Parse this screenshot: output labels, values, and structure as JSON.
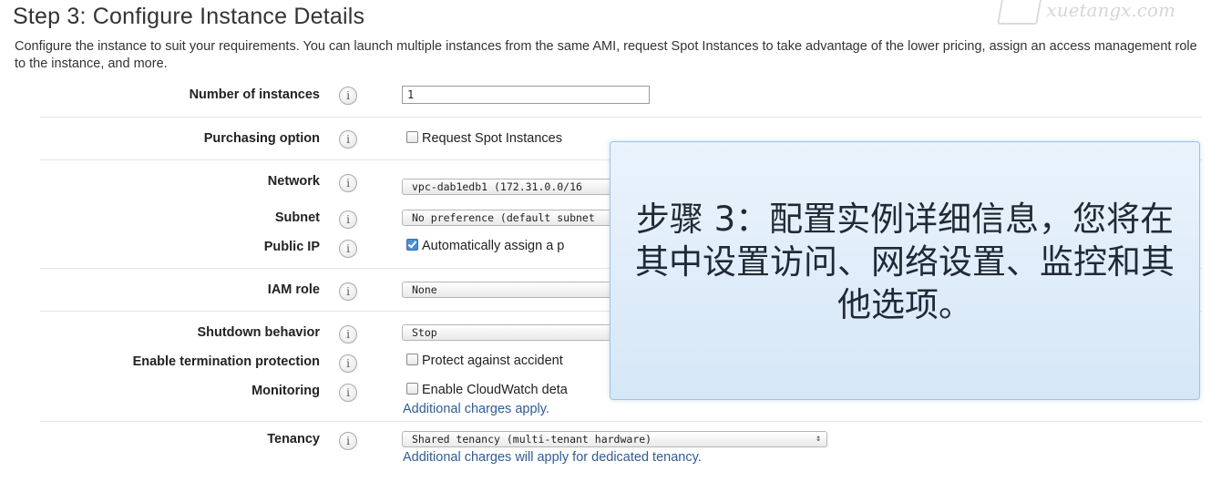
{
  "page": {
    "title": "Step 3: Configure Instance Details",
    "description": "Configure the instance to suit your requirements. You can launch multiple instances from the same AMI, request Spot Instances to take advantage of the lower pricing, assign an access management role to the instance, and more."
  },
  "watermark": {
    "text": "xuetangx.com"
  },
  "form": {
    "number_of_instances": {
      "label": "Number of instances",
      "value": "1",
      "info_icon": "i"
    },
    "purchasing_option": {
      "label": "Purchasing option",
      "checkbox_label": "Request Spot Instances",
      "checked": false,
      "info_icon": "i"
    },
    "network": {
      "label": "Network",
      "selected": "vpc-dab1edb1 (172.31.0.0/16",
      "info_icon": "i"
    },
    "subnet": {
      "label": "Subnet",
      "selected": "No preference (default subnet",
      "info_icon": "i"
    },
    "public_ip": {
      "label": "Public IP",
      "checkbox_label": "Automatically assign a p",
      "checked": true,
      "info_icon": "i"
    },
    "iam_role": {
      "label": "IAM role",
      "selected": "None",
      "info_icon": "i"
    },
    "shutdown_behavior": {
      "label": "Shutdown behavior",
      "selected": "Stop",
      "info_icon": "i"
    },
    "termination_protection": {
      "label": "Enable termination protection",
      "checkbox_label": "Protect against accident",
      "checked": false,
      "info_icon": "i"
    },
    "monitoring": {
      "label": "Monitoring",
      "checkbox_label": "Enable CloudWatch deta",
      "checked": false,
      "note": "Additional charges apply.",
      "info_icon": "i"
    },
    "tenancy": {
      "label": "Tenancy",
      "selected": "Shared tenancy (multi-tenant hardware)",
      "note": "Additional charges will apply for dedicated tenancy.",
      "info_icon": "i"
    }
  },
  "overlay": {
    "text": "步骤 3：配置实例详细信息，您将在其中设置访问、网络设置、监控和其他选项。"
  },
  "colors": {
    "link": "#2e5c9a",
    "overlay_border": "#9cc3e8",
    "checkbox_on": "#4a8cd8"
  }
}
